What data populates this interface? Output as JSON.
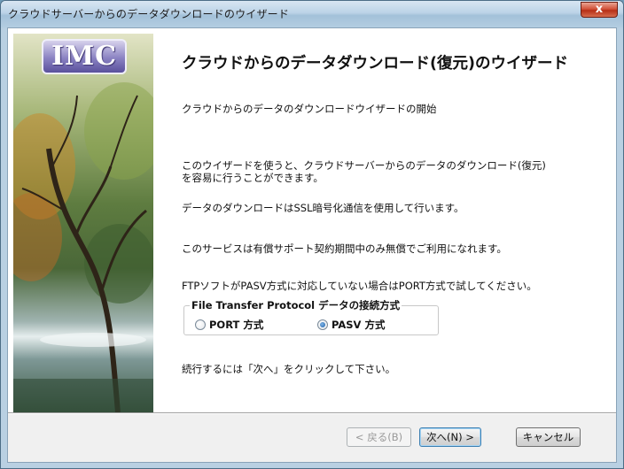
{
  "window": {
    "title": "クラウドサーバーからのデータダウンロードのウイザード",
    "close_glyph": "x"
  },
  "logo": {
    "text": "IMC"
  },
  "main": {
    "heading": "クラウドからのデータダウンロード(復元)のウイザード",
    "subtitle": "クラウドからのデータのダウンロードウイザードの開始",
    "para1_line1": "このウイザードを使うと、クラウドサーバーからのデータのダウンロード(復元)",
    "para1_line2": "を容易に行うことができます。",
    "ssl_note": "データのダウンロードはSSL暗号化通信を使用して行います。",
    "service_note": "このサービスは有償サポート契約期間中のみ無償でご利用になれます。",
    "ftp_note": "FTPソフトがPASV方式に対応していない場合はPORT方式で試してください。",
    "continue_note": "続行するには「次へ」をクリックして下さい。"
  },
  "connection_group": {
    "legend": "File Transfer Protocol データの接続方式",
    "options": [
      {
        "label": "PORT 方式",
        "checked": false
      },
      {
        "label": "PASV 方式",
        "checked": true
      }
    ]
  },
  "buttons": {
    "back": "< 戻る(B)",
    "next": "次へ(N) >",
    "cancel": "キャンセル"
  }
}
